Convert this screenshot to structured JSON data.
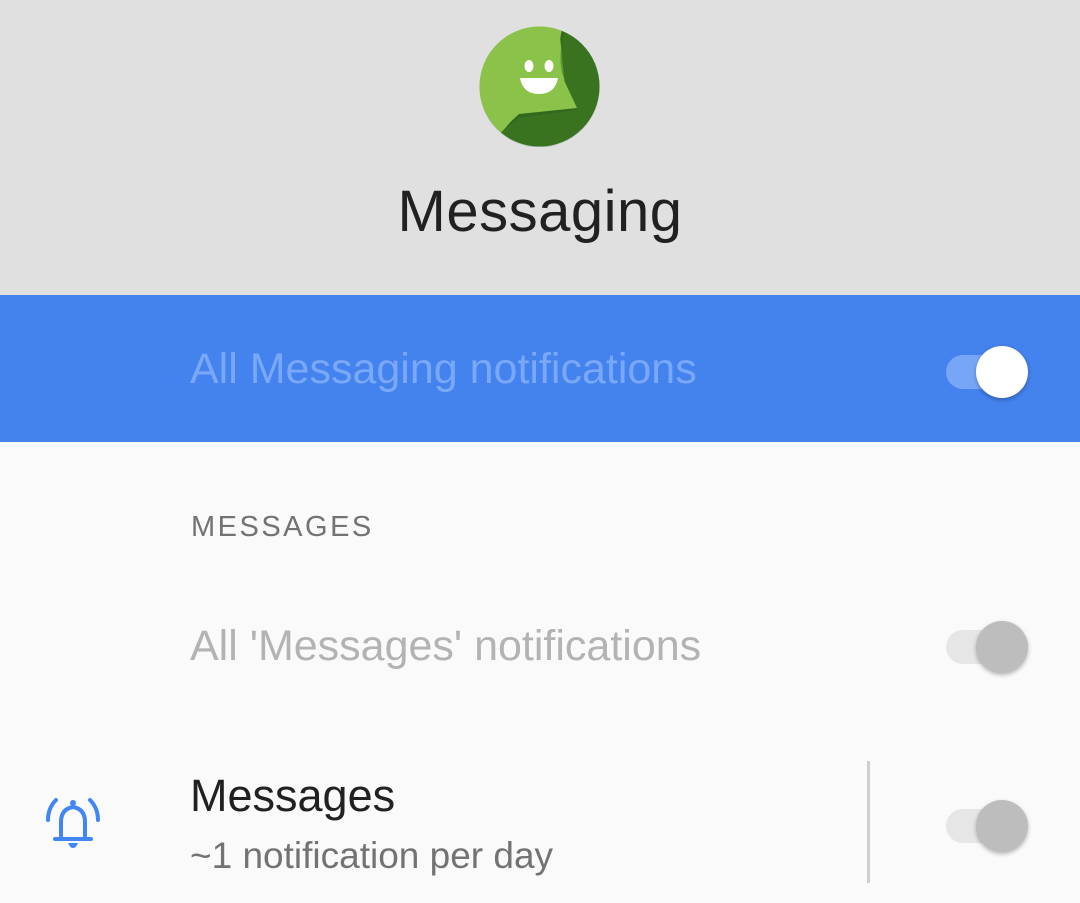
{
  "app": {
    "title": "Messaging",
    "icon": "messaging-app-icon",
    "icon_colors": {
      "primary": "#8bc34a",
      "shade": "#33691e"
    }
  },
  "master_toggle": {
    "label": "All Messaging notifications",
    "state": "on",
    "background": "#4482ee"
  },
  "category": {
    "header": "MESSAGES",
    "all_toggle": {
      "label": "All 'Messages' notifications",
      "state": "off",
      "enabled": false
    },
    "channels": [
      {
        "icon": "bell-icon",
        "title": "Messages",
        "summary": "~1 notification per day",
        "state": "off"
      }
    ]
  }
}
